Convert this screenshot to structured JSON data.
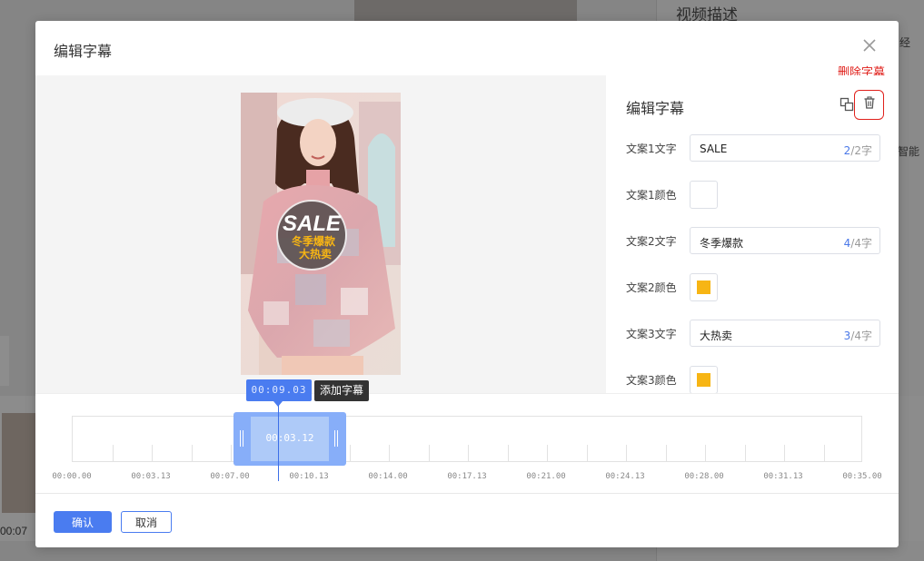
{
  "background": {
    "right_title": "视频描述",
    "right_extra": "智能",
    "right_extra2": "经",
    "left_time": "00:07"
  },
  "modal": {
    "title": "编辑字幕",
    "delete_hint": "删除字幕",
    "preview": {
      "sale_text": "SALE",
      "line1": "冬季爆款",
      "line2": "大热卖"
    },
    "panel": {
      "title": "编辑字幕",
      "rows": [
        {
          "label": "文案1文字",
          "value": "SALE",
          "count_cur": "2",
          "count_max": "/2字"
        },
        {
          "label": "文案1颜色",
          "color": "#ffffff"
        },
        {
          "label": "文案2文字",
          "value": "冬季爆款",
          "count_cur": "4",
          "count_max": "/4字"
        },
        {
          "label": "文案2颜色",
          "color": "#f7b514"
        },
        {
          "label": "文案3文字",
          "value": "大热卖",
          "count_cur": "3",
          "count_max": "/4字"
        },
        {
          "label": "文案3颜色",
          "color": "#f7b514"
        }
      ]
    },
    "timeline": {
      "playhead_time": "00:09.03",
      "add_tip": "添加字幕",
      "clip_time": "00:03.12",
      "ticks": [
        "00:00.00",
        "00:03.13",
        "00:07.00",
        "00:10.13",
        "00:14.00",
        "00:17.13",
        "00:21.00",
        "00:24.13",
        "00:28.00",
        "00:31.13",
        "00:35.00"
      ]
    },
    "footer": {
      "ok_label": "确认",
      "cancel_label": "取消"
    }
  },
  "colors": {
    "accent": "#4a7cf0",
    "danger": "#e0211c"
  }
}
